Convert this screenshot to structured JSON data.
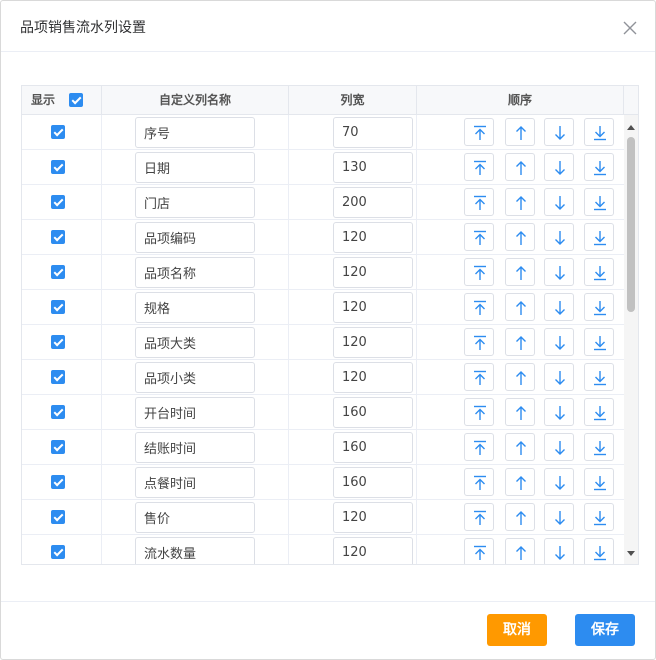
{
  "dialog": {
    "title": "品项销售流水列设置",
    "close_icon": "close-icon"
  },
  "table": {
    "headers": {
      "show": "显示",
      "name": "自定义列名称",
      "width": "列宽",
      "order": "顺序"
    },
    "header_all_checked": true,
    "rows": [
      {
        "checked": true,
        "name": "序号",
        "width": "70"
      },
      {
        "checked": true,
        "name": "日期",
        "width": "130"
      },
      {
        "checked": true,
        "name": "门店",
        "width": "200"
      },
      {
        "checked": true,
        "name": "品项编码",
        "width": "120"
      },
      {
        "checked": true,
        "name": "品项名称",
        "width": "120"
      },
      {
        "checked": true,
        "name": "规格",
        "width": "120"
      },
      {
        "checked": true,
        "name": "品项大类",
        "width": "120"
      },
      {
        "checked": true,
        "name": "品项小类",
        "width": "120"
      },
      {
        "checked": true,
        "name": "开台时间",
        "width": "160"
      },
      {
        "checked": true,
        "name": "结账时间",
        "width": "160"
      },
      {
        "checked": true,
        "name": "点餐时间",
        "width": "160"
      },
      {
        "checked": true,
        "name": "售价",
        "width": "120"
      },
      {
        "checked": true,
        "name": "流水数量",
        "width": "120"
      }
    ],
    "order_icons": [
      "move-top-icon",
      "move-up-icon",
      "move-down-icon",
      "move-bottom-icon"
    ]
  },
  "footer": {
    "cancel_label": "取消",
    "save_label": "保存"
  },
  "colors": {
    "primary": "#2d8cf0",
    "warning": "#ff9900"
  }
}
